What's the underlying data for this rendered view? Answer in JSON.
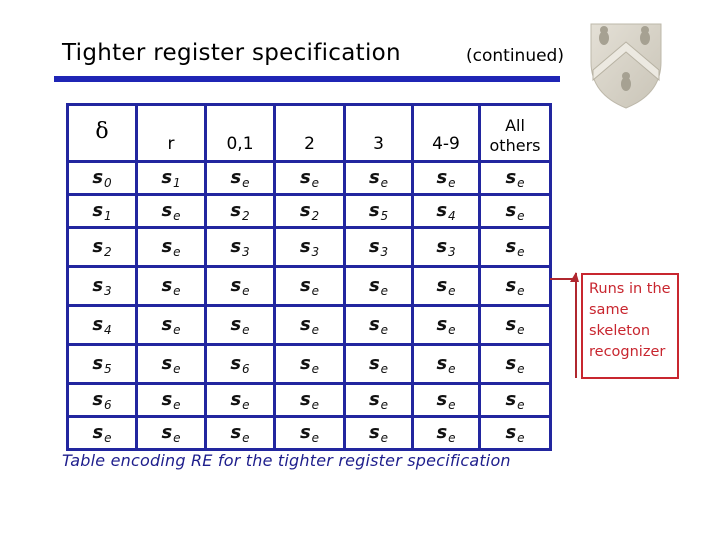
{
  "slide": {
    "title": "Tighter register specification",
    "subtitle": "(continued)",
    "caption": "Table encoding RE for the tighter register specification",
    "callout": "Runs in the same skeleton recognizer",
    "colors": {
      "accent_blue": "#1f25b5",
      "table_border": "#22269f",
      "caption_text": "#1e1e8c",
      "callout_red": "#c8262f"
    },
    "logo": "shield-crest-icon"
  },
  "table": {
    "headers": [
      "δ",
      "r",
      "0,1",
      "2",
      "3",
      "4-9",
      "All others"
    ],
    "rows": [
      [
        {
          "b": "s",
          "s": "0"
        },
        {
          "b": "s",
          "s": "1"
        },
        {
          "b": "s",
          "s": "e"
        },
        {
          "b": "s",
          "s": "e"
        },
        {
          "b": "s",
          "s": "e"
        },
        {
          "b": "s",
          "s": "e"
        },
        {
          "b": "s",
          "s": "e"
        }
      ],
      [
        {
          "b": "s",
          "s": "1"
        },
        {
          "b": "s",
          "s": "e"
        },
        {
          "b": "s",
          "s": "2"
        },
        {
          "b": "s",
          "s": "2"
        },
        {
          "b": "s",
          "s": "5"
        },
        {
          "b": "s",
          "s": "4"
        },
        {
          "b": "s",
          "s": "e"
        }
      ],
      [
        {
          "b": "s",
          "s": "2"
        },
        {
          "b": "s",
          "s": "e"
        },
        {
          "b": "s",
          "s": "3"
        },
        {
          "b": "s",
          "s": "3"
        },
        {
          "b": "s",
          "s": "3"
        },
        {
          "b": "s",
          "s": "3"
        },
        {
          "b": "s",
          "s": "e"
        }
      ],
      [
        {
          "b": "s",
          "s": "3"
        },
        {
          "b": "s",
          "s": "e"
        },
        {
          "b": "s",
          "s": "e"
        },
        {
          "b": "s",
          "s": "e"
        },
        {
          "b": "s",
          "s": "e"
        },
        {
          "b": "s",
          "s": "e"
        },
        {
          "b": "s",
          "s": "e"
        }
      ],
      [
        {
          "b": "s",
          "s": "4"
        },
        {
          "b": "s",
          "s": "e"
        },
        {
          "b": "s",
          "s": "e"
        },
        {
          "b": "s",
          "s": "e"
        },
        {
          "b": "s",
          "s": "e"
        },
        {
          "b": "s",
          "s": "e"
        },
        {
          "b": "s",
          "s": "e"
        }
      ],
      [
        {
          "b": "s",
          "s": "5"
        },
        {
          "b": "s",
          "s": "e"
        },
        {
          "b": "s",
          "s": "6"
        },
        {
          "b": "s",
          "s": "e"
        },
        {
          "b": "s",
          "s": "e"
        },
        {
          "b": "s",
          "s": "e"
        },
        {
          "b": "s",
          "s": "e"
        }
      ],
      [
        {
          "b": "s",
          "s": "6"
        },
        {
          "b": "s",
          "s": "e"
        },
        {
          "b": "s",
          "s": "e"
        },
        {
          "b": "s",
          "s": "e"
        },
        {
          "b": "s",
          "s": "e"
        },
        {
          "b": "s",
          "s": "e"
        },
        {
          "b": "s",
          "s": "e"
        }
      ],
      [
        {
          "b": "s",
          "s": "e"
        },
        {
          "b": "s",
          "s": "e"
        },
        {
          "b": "s",
          "s": "e"
        },
        {
          "b": "s",
          "s": "e"
        },
        {
          "b": "s",
          "s": "e"
        },
        {
          "b": "s",
          "s": "e"
        },
        {
          "b": "s",
          "s": "e"
        }
      ]
    ]
  }
}
